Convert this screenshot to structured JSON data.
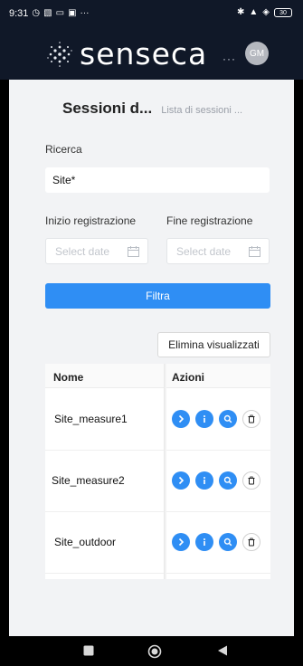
{
  "status_bar": {
    "time": "9:31",
    "battery": "30"
  },
  "header": {
    "logo_text": "senseca",
    "more_label": "···",
    "avatar_initials": "GM"
  },
  "page": {
    "title": "Sessioni d...",
    "subtitle": "Lista di sessioni ..."
  },
  "search": {
    "label": "Ricerca",
    "value": "Site*"
  },
  "dates": {
    "start_label": "Inizio registrazione",
    "end_label": "Fine registrazione",
    "start_placeholder": "Select date",
    "end_placeholder": "Select date"
  },
  "filter_button": "Filtra",
  "clear_button": "Elimina visualizzati",
  "table": {
    "columns": [
      "Nome",
      "Azioni"
    ],
    "rows": [
      {
        "name": "Site_measure1"
      },
      {
        "name": "Site_measure2"
      },
      {
        "name": "Site_outdoor"
      }
    ]
  },
  "colors": {
    "accent": "#2f8ef4",
    "header_bg": "#101828",
    "page_bg": "#f2f3f5"
  },
  "icons": {
    "row_actions": [
      "open-icon",
      "info-icon",
      "search-icon",
      "trash-icon"
    ],
    "nav": [
      "recents-icon",
      "home-icon",
      "back-icon"
    ]
  }
}
